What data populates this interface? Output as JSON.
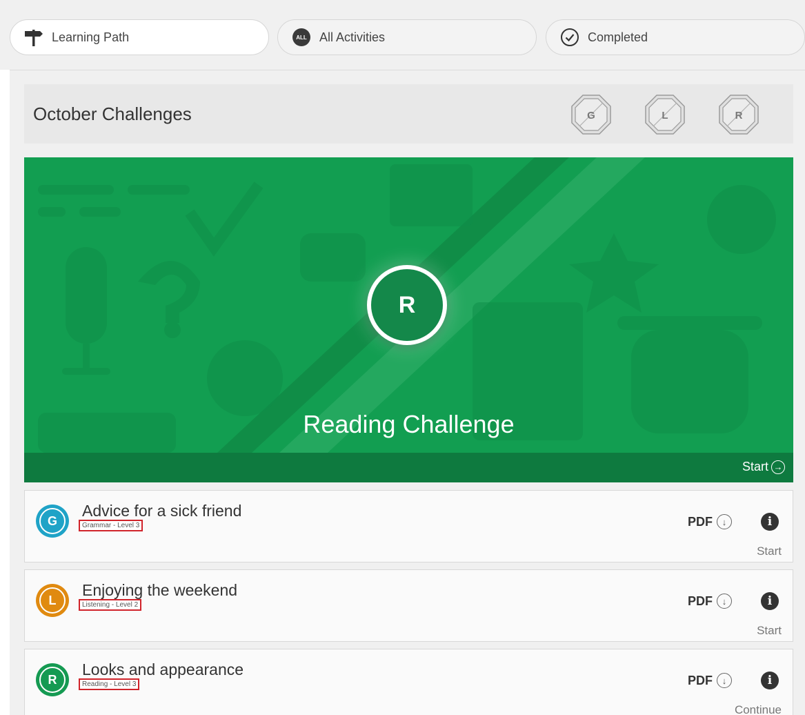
{
  "tabs": [
    {
      "label": "Learning Path",
      "icon": "signpost-icon"
    },
    {
      "label": "All Activities",
      "icon": "all-badge-icon",
      "badge": "ALL"
    },
    {
      "label": "Completed",
      "icon": "check-circle-icon"
    }
  ],
  "challenges": {
    "title": "October Challenges",
    "badges": [
      "G",
      "L",
      "R"
    ]
  },
  "hero": {
    "letter": "R",
    "title": "Reading Challenge",
    "start_label": "Start",
    "color": "#129e51"
  },
  "activities": [
    {
      "letter": "G",
      "title": "Advice for a sick friend",
      "level": "Grammar - Level 3",
      "pdf_label": "PDF",
      "action": "Start",
      "color": "#1fa3c7"
    },
    {
      "letter": "L",
      "title": "Enjoying the weekend",
      "level": "Listening - Level 2",
      "pdf_label": "PDF",
      "action": "Start",
      "color": "#e08a10"
    },
    {
      "letter": "R",
      "title": "Looks and appearance",
      "level": "Reading - Level 3",
      "pdf_label": "PDF",
      "action": "Continue",
      "color": "#159a52"
    }
  ]
}
